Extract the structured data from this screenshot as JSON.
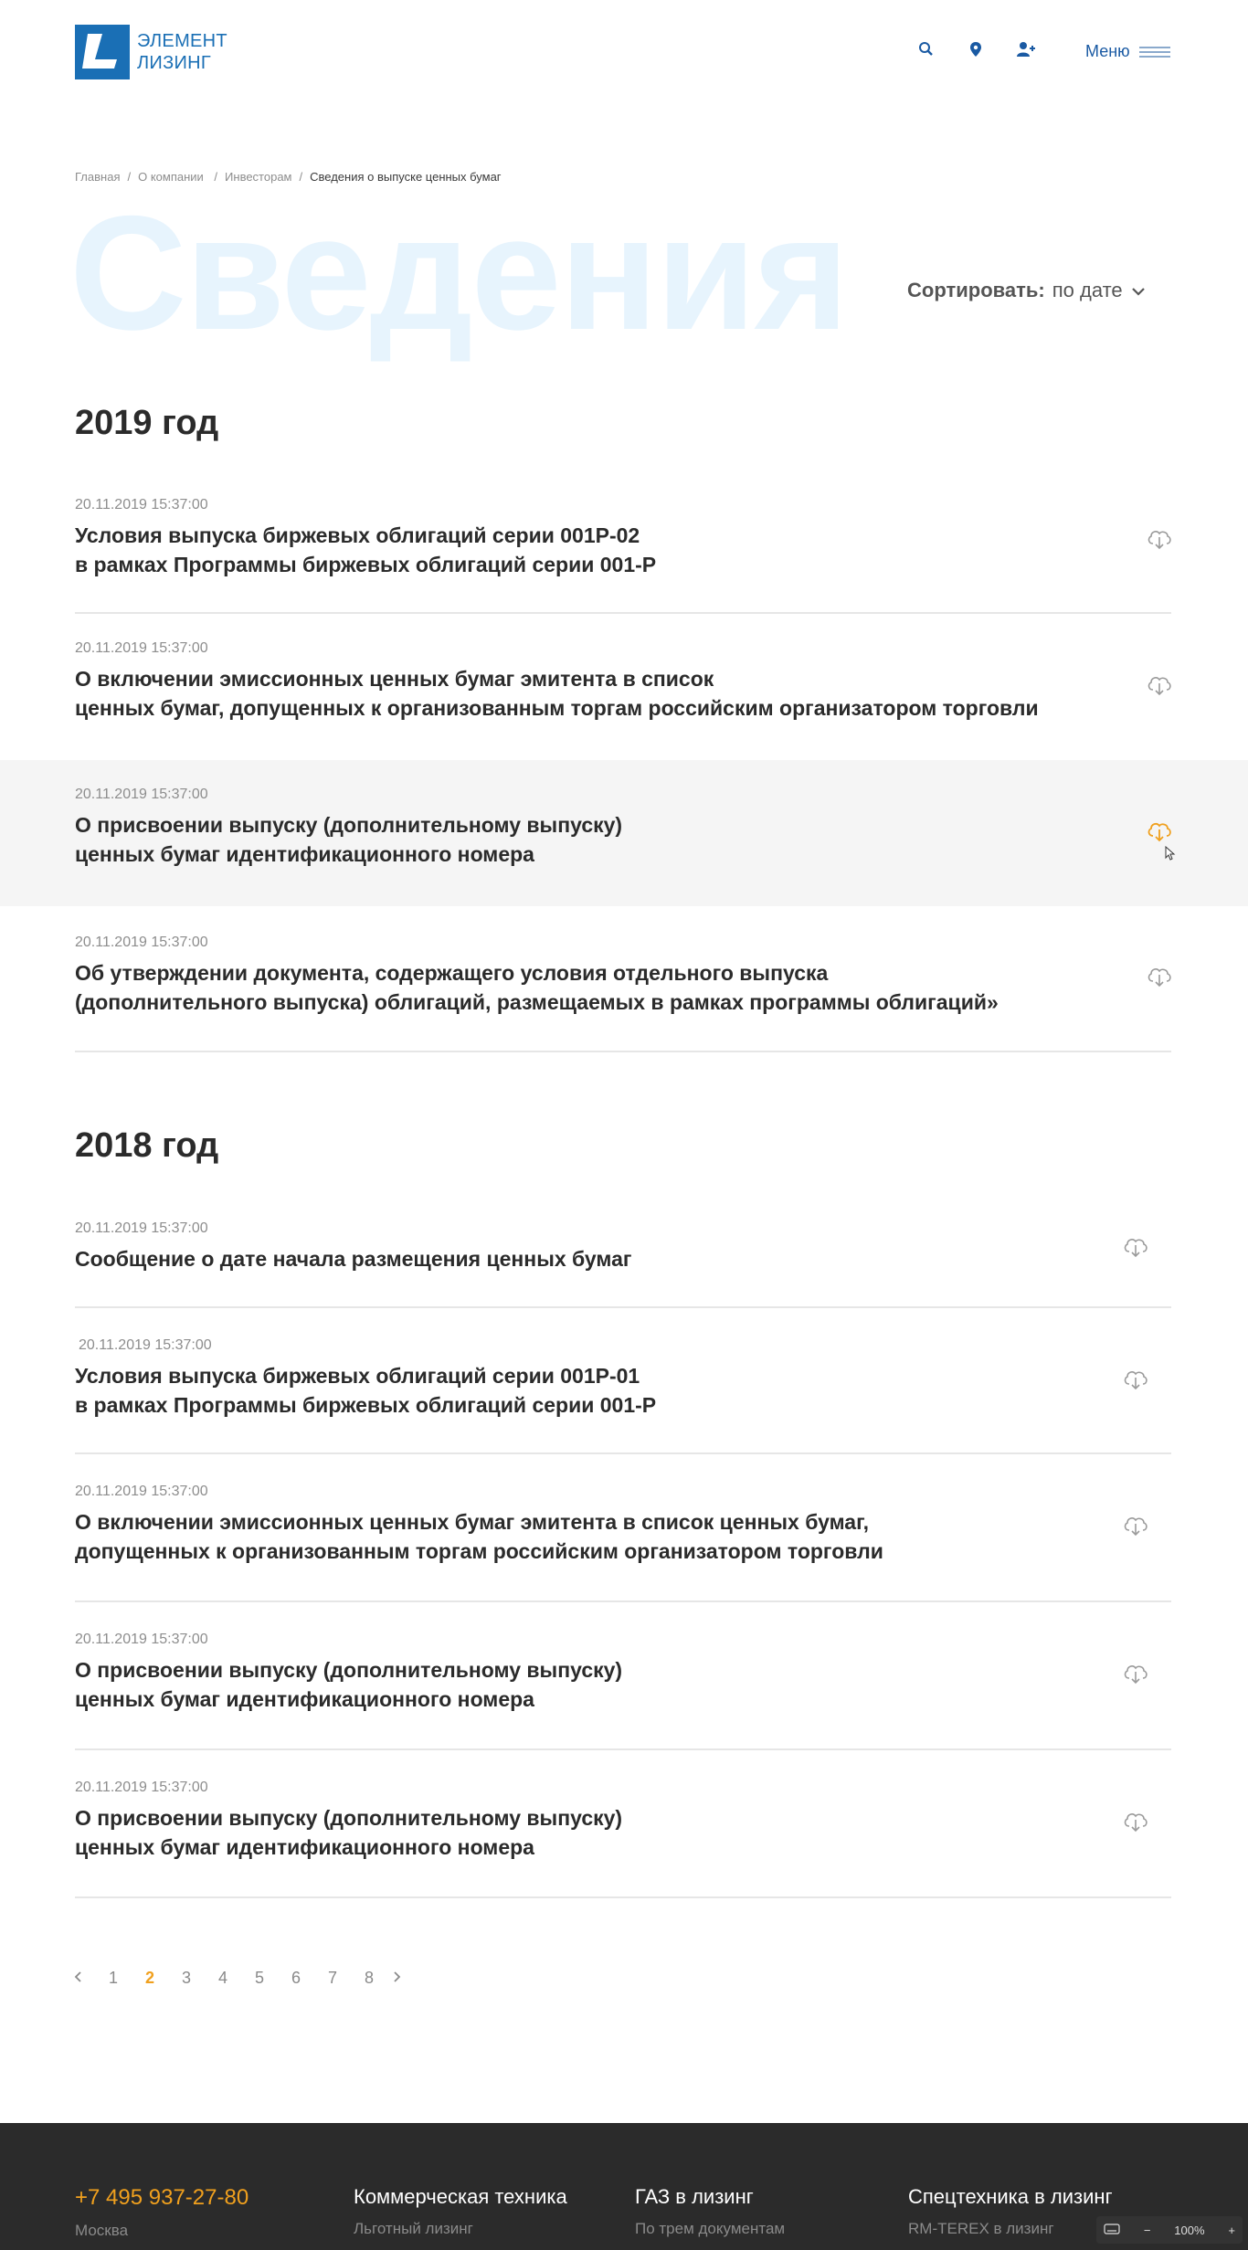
{
  "header": {
    "logo_line1": "ЭЛЕМЕНТ",
    "logo_line2": "ЛИЗИНГ",
    "menu_label": "Меню",
    "icons": [
      "search-icon",
      "location-pin-icon",
      "user-add-icon"
    ]
  },
  "breadcrumb": {
    "items": [
      "Главная",
      "О компании",
      "Инвесторам"
    ],
    "current": "Сведения о выпуске ценных бумаг"
  },
  "hero": {
    "title": "Сведения",
    "sort_label": "Сортировать:",
    "sort_value": "по дате"
  },
  "sections": [
    {
      "year": "2019 год",
      "docs": [
        {
          "date": "20.11.2019 15:37:00",
          "title": "Условия выпуска биржевых облигаций серии 001Р-02\nв рамках Программы биржевых облигаций серии 001-Р"
        },
        {
          "date": "20.11.2019 15:37:00",
          "title": "О включении эмиссионных ценных бумаг эмитента в список\nценных бумаг, допущенных к организованным торгам российским организатором торговли"
        },
        {
          "date": "20.11.2019 15:37:00",
          "title": "О присвоении выпуску (дополнительному выпуску)\nценных бумаг идентификационного номера"
        },
        {
          "date": "20.11.2019 15:37:00",
          "title": "Об утверждении документа, содержащего условия отдельного выпуска\n(дополнительного выпуска) облигаций, размещаемых в рамках программы облигаций»"
        }
      ]
    },
    {
      "year": "2018 год",
      "docs": [
        {
          "date": "20.11.2019 15:37:00",
          "title": "Сообщение о дате начала размещения ценных бумаг"
        },
        {
          "date": "20.11.2019 15:37:00",
          "title": "Условия выпуска биржевых облигаций серии 001Р-01\nв рамках Программы биржевых облигаций серии 001-Р"
        },
        {
          "date": "20.11.2019 15:37:00",
          "title": "О включении эмиссионных ценных бумаг эмитента в список ценных бумаг,\nдопущенных к организованным торгам российским организатором торговли"
        },
        {
          "date": "20.11.2019 15:37:00",
          "title": "О присвоении выпуску (дополнительному выпуску)\nценных бумаг идентификационного номера"
        },
        {
          "date": "20.11.2019 15:37:00",
          "title": "О присвоении выпуску (дополнительному выпуску)\nценных бумаг идентификационного номера"
        }
      ]
    }
  ],
  "pagination": {
    "pages": [
      "1",
      "2",
      "3",
      "4",
      "5",
      "6",
      "7",
      "8"
    ],
    "current": "2"
  },
  "footer": {
    "phone": "+7 495 937-27-80",
    "city": "Москва",
    "col2_head": "Коммерческая техника",
    "col2_sub": "Льготный лизинг",
    "col3_head": "ГАЗ в лизинг",
    "col3_sub": "По трем документам",
    "col4_head": "Спецтехника в лизинг",
    "col4_sub": "RM-TEREX в лизинг"
  },
  "zoom": {
    "level": "100%",
    "minus": "−",
    "plus": "+"
  },
  "colors": {
    "brand": "#1a6fb5",
    "accent": "#f0a01e",
    "hero_bg_text": "#e7f4fd",
    "footer_bg": "#2b2b2b"
  }
}
